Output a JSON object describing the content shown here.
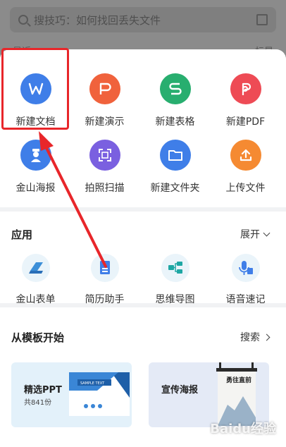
{
  "search": {
    "placeholder": "搜技巧：如何找回丢失文件"
  },
  "background": {
    "left_label": "最近",
    "right_label": "标星"
  },
  "create_grid": {
    "items": [
      {
        "label": "新建文档",
        "icon": "word-icon",
        "color": "#3f7ee8",
        "glyph": "W"
      },
      {
        "label": "新建演示",
        "icon": "presentation-icon",
        "color": "#f0623c",
        "glyph": "P"
      },
      {
        "label": "新建表格",
        "icon": "spreadsheet-icon",
        "color": "#28ae6f",
        "glyph": "S"
      },
      {
        "label": "新建PDF",
        "icon": "pdf-icon",
        "color": "#ee4b55",
        "glyph": "P"
      },
      {
        "label": "金山海报",
        "icon": "poster-icon",
        "color": "#3f7ee8",
        "glyph": ""
      },
      {
        "label": "拍照扫描",
        "icon": "scan-icon",
        "color": "#7a60e0",
        "glyph": ""
      },
      {
        "label": "新建文件夹",
        "icon": "folder-icon",
        "color": "#3f7ee8",
        "glyph": ""
      },
      {
        "label": "上传文件",
        "icon": "upload-icon",
        "color": "#f58a32",
        "glyph": ""
      }
    ]
  },
  "apps": {
    "title": "应用",
    "expand_label": "展开",
    "items": [
      {
        "label": "金山表单",
        "icon": "form-icon"
      },
      {
        "label": "简历助手",
        "icon": "resume-icon"
      },
      {
        "label": "思维导图",
        "icon": "mindmap-icon"
      },
      {
        "label": "语音速记",
        "icon": "voice-note-icon"
      }
    ]
  },
  "templates": {
    "title": "从模板开始",
    "search_label": "搜索",
    "cards": [
      {
        "title": "精选PPT",
        "subtitle": "共841份",
        "preview_text": "SAMPLE TEXT"
      },
      {
        "title": "宣传海报",
        "preview_text": "勇往直前"
      }
    ]
  },
  "watermark": "Baidu经验",
  "colors": {
    "highlight": "#e8262a",
    "arrow": "#e8262a"
  }
}
